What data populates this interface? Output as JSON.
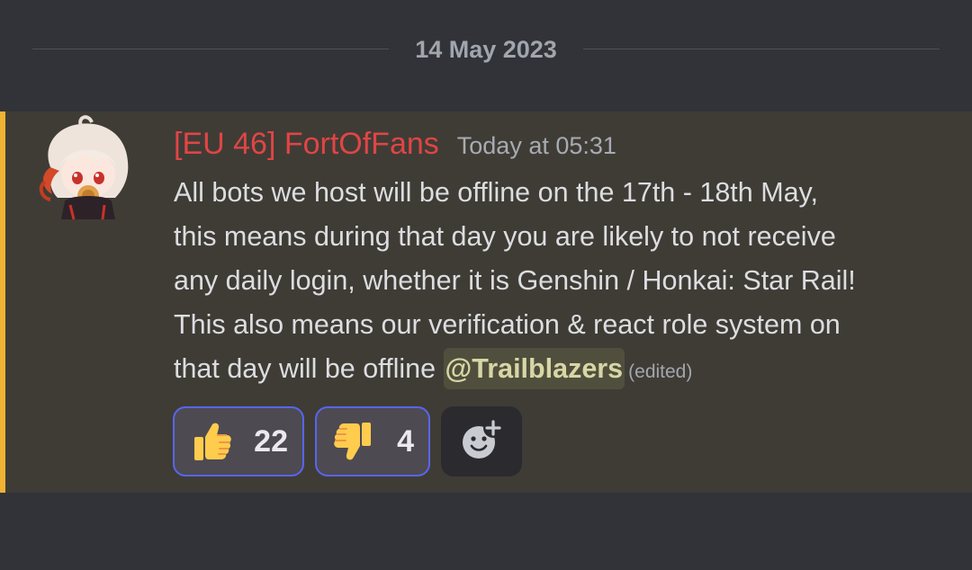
{
  "date_divider": "14 May 2023",
  "message": {
    "username": "[EU 46] FortOfFans",
    "timestamp": "Today at 05:31",
    "line1": "All bots we host will be offline on the 17th - 18th May,",
    "line2": "this means during that day you are likely to not receive",
    "line3": "any daily login, whether it is Genshin / Honkai: Star Rail!",
    "line4": "This also means our verification & react role system on",
    "line5_prefix": "that day will be offline ",
    "mention": "@Trailblazers",
    "edited": "(edited)",
    "username_color": "#e04545",
    "mention_bar_color": "#f0b232"
  },
  "reactions": [
    {
      "emoji": "thumbs-up-icon",
      "count": "22"
    },
    {
      "emoji": "thumbs-down-icon",
      "count": "4"
    }
  ],
  "add_reaction_icon": "add-reaction-icon"
}
